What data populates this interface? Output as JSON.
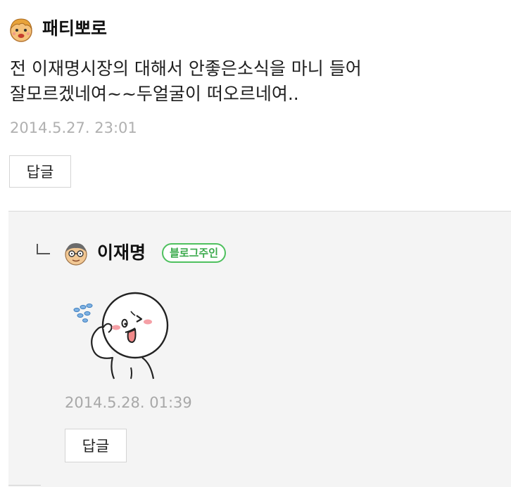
{
  "comment": {
    "nickname": "패티뽀로",
    "avatar_icon": "emoji-face-avatar-icon",
    "lines": [
      "전 이재명시장의 대해서 안좋은소식을 마니 들어",
      "잘모르겠네여~~두얼굴이 떠오르네여.."
    ],
    "date": "2014.5.27. 23:01",
    "reply_label": "답글"
  },
  "reply": {
    "arrow_icon": "reply-arrow-icon",
    "nickname": "이재명",
    "avatar_icon": "glasses-man-avatar-icon",
    "badge": "블로그주인",
    "sticker_icon": "wink-tongue-sticker-icon",
    "date": "2014.5.28. 01:39",
    "reply_label": "답글"
  },
  "colors": {
    "badge_green": "#3aa94b",
    "reply_bg": "#f4f4f4",
    "date_gray": "#b0b0b0"
  }
}
